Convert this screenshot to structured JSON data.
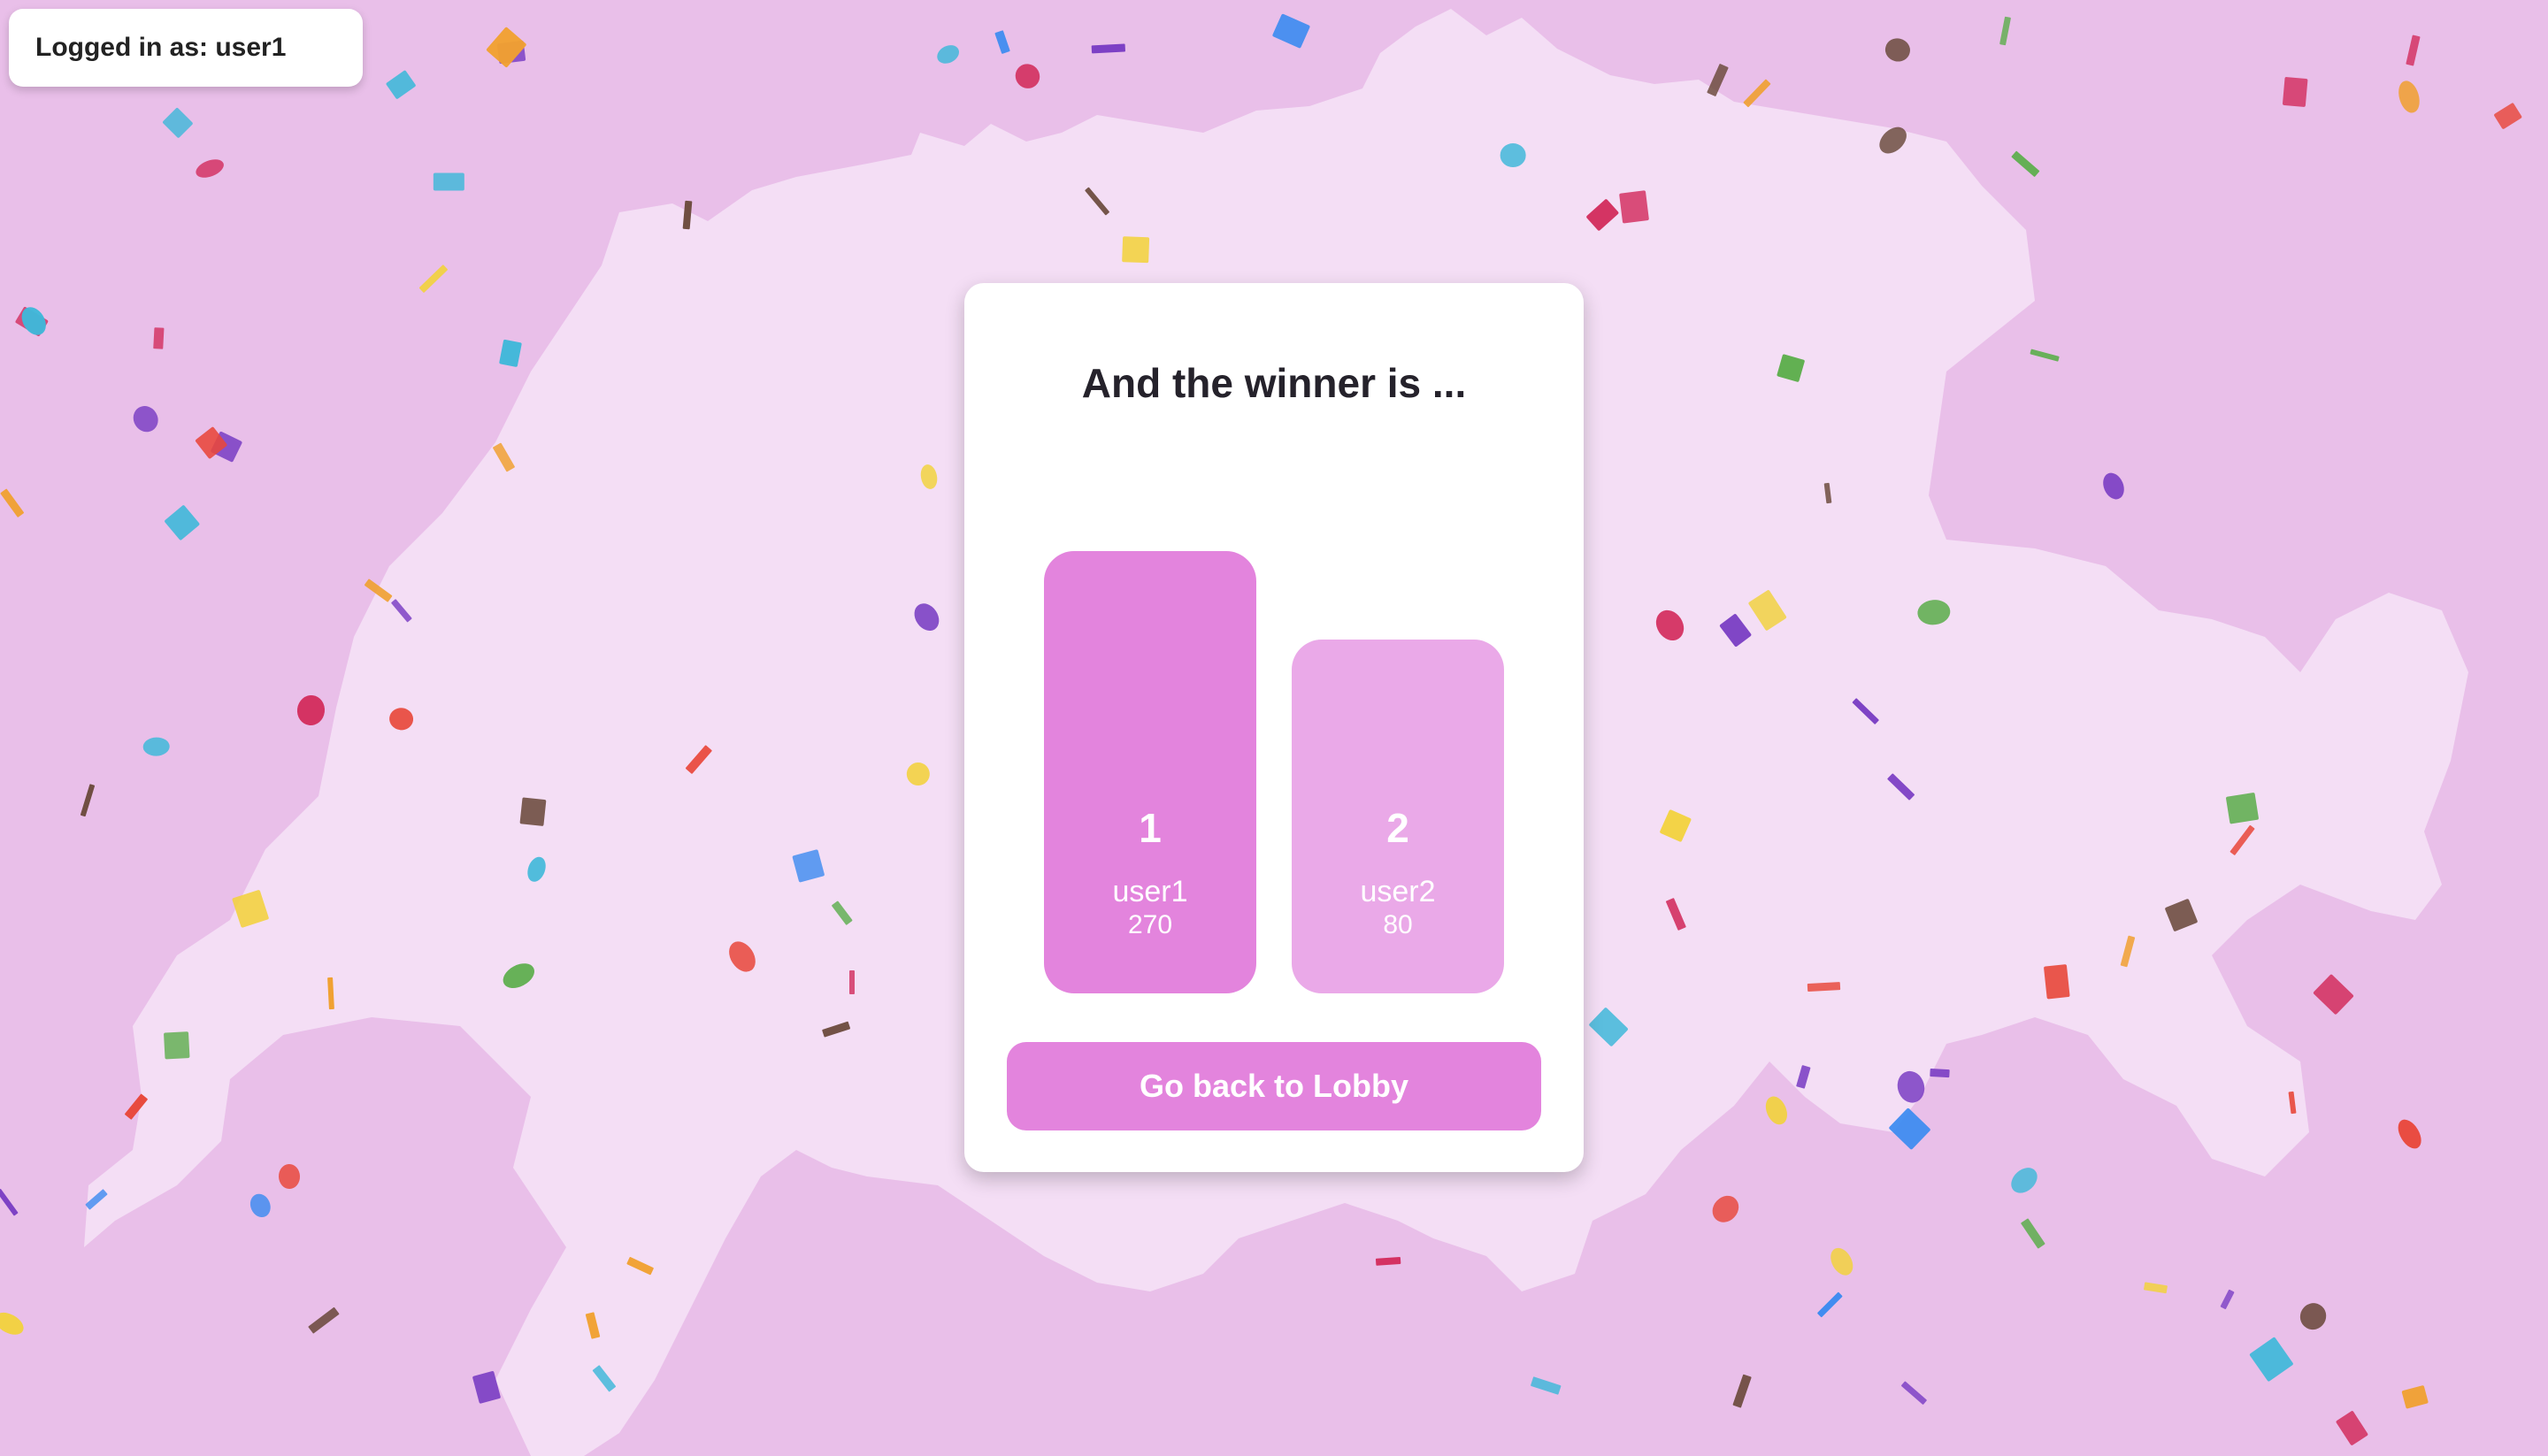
{
  "login": {
    "label": "Logged in as: user1"
  },
  "result": {
    "title": "And the winner is ...",
    "podium": [
      {
        "rank": "1",
        "name": "user1",
        "score": "270"
      },
      {
        "rank": "2",
        "name": "user2",
        "score": "80"
      }
    ],
    "lobby_button_label": "Go back to Lobby"
  },
  "colors": {
    "background": "#e9bfe9",
    "map_fill": "#f4def5",
    "accent": "#e384dd",
    "second_place": "#eaa9e8",
    "confetti": [
      "#e8473a",
      "#3f8cf0",
      "#7b3fc4",
      "#5fae4f",
      "#f2d23c",
      "#3fb8d9",
      "#6b4a3c",
      "#f0a030",
      "#d33060"
    ]
  }
}
